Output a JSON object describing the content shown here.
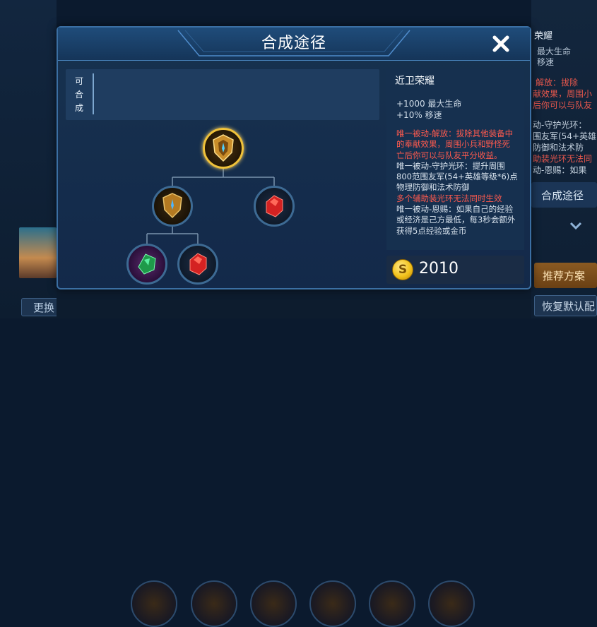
{
  "background": {
    "right_panel": {
      "title": "荣耀",
      "stats": [
        "最大生命",
        "移速"
      ],
      "desc_lines": [
        "解放：拔除",
        "献效果，周围小",
        "后你可以与队友",
        "动-守护光环：",
        "围友军(54+英雄",
        "防御和法术防",
        "助装光环无法同",
        "动-恩赐：如果"
      ],
      "craft_button": "合成途径",
      "recommend_button": "推荐方案",
      "restore_button": "恢复默认配"
    },
    "left_panel": {
      "swap_button": "更换"
    }
  },
  "modal": {
    "title": "合成途径",
    "craftable_label": "可合成",
    "tree": {
      "root": "近卫荣耀",
      "children": [
        "近卫荣耀组件",
        "红玛瑙"
      ],
      "grandchildren": [
        "绿宝石",
        "红玛瑙"
      ]
    }
  },
  "item": {
    "name": "近卫荣耀",
    "stats": [
      "+1000 最大生命",
      "+10% 移速"
    ],
    "passives": [
      {
        "text": "唯一被动-解放：拔除其他装备中的奉献效果，周围小兵和野怪死亡后你可以与队友平分收益。",
        "color": "red"
      },
      {
        "text": "唯一被动-守护光环：提升周围800范围友军(54+英雄等级*6)点物理防御和法术防御",
        "color": "white"
      },
      {
        "text": "多个辅助装光环无法同时生效",
        "color": "red"
      },
      {
        "text": "唯一被动-恩赐：如果自己的经验或经济是己方最低，每3秒会额外获得5点经验或金币",
        "color": "white"
      }
    ],
    "price": "2010",
    "coin_symbol": "S"
  },
  "colors": {
    "accent_blue": "#3b6fa3",
    "passive_red": "#ff5a4e",
    "gold": "#f2c21b"
  }
}
